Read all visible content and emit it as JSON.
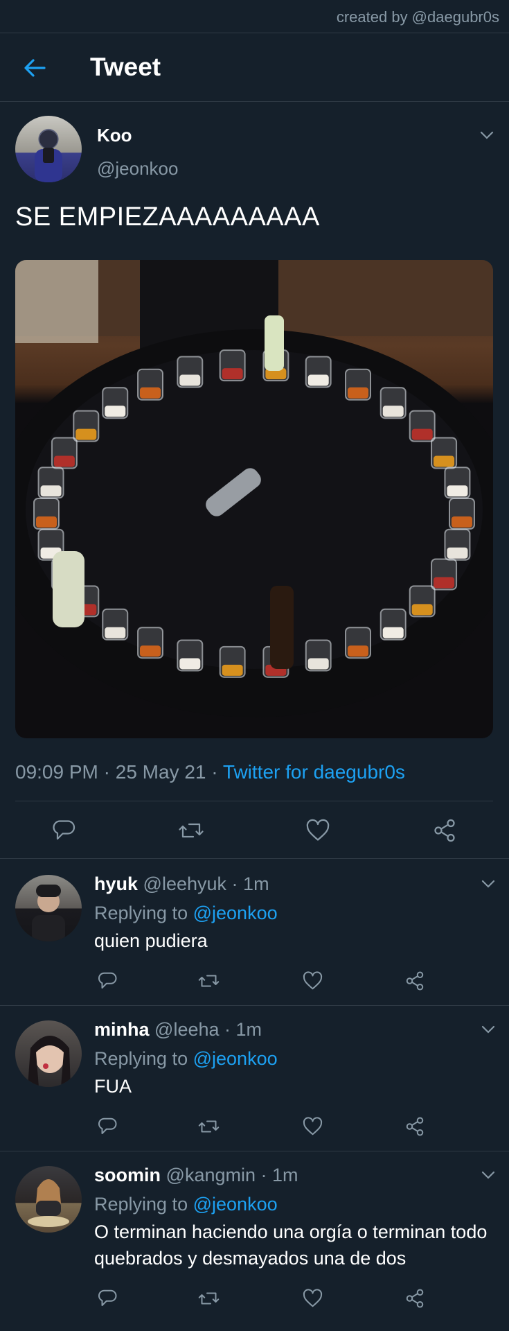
{
  "watermark": "created by @daegubr0s",
  "header": {
    "title": "Tweet"
  },
  "tweet": {
    "name": "Koo",
    "handle": "@jeonkoo",
    "text": "SE EMPIEZAAAAAAAAA",
    "time": "09:09 PM",
    "date": "25 May 21",
    "source": "Twitter for daegubr0s"
  },
  "replies": [
    {
      "name": "hyuk",
      "handle": "@leehyuk",
      "time": "1m",
      "replying_label": "Replying to",
      "replying_to": "@jeonkoo",
      "text": "quien pudiera"
    },
    {
      "name": "minha",
      "handle": "@leeha",
      "time": "1m",
      "replying_label": "Replying to",
      "replying_to": "@jeonkoo",
      "text": "FUA"
    },
    {
      "name": "soomin",
      "handle": "@kangmin",
      "time": "1m",
      "replying_label": "Replying to",
      "replying_to": "@jeonkoo",
      "text": "O terminan haciendo una orgía o terminan todo quebrados y desmayados una de dos"
    }
  ],
  "icons": {
    "back": "arrow-left-icon",
    "reply": "comment-icon",
    "retweet": "retweet-icon",
    "like": "heart-icon",
    "share": "share-icon",
    "more": "chevron-down-icon"
  },
  "colors": {
    "background": "#15202b",
    "accent": "#1da1f2",
    "secondary_text": "#8899a6",
    "divider": "#2f3a45"
  }
}
